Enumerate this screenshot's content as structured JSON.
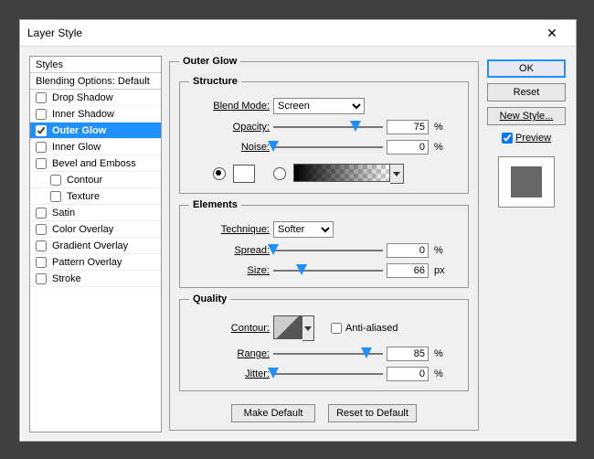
{
  "dialog": {
    "title": "Layer Style"
  },
  "styles_panel": {
    "header": "Styles",
    "blending": "Blending Options: Default",
    "items": [
      {
        "label": "Drop Shadow",
        "checked": false,
        "selected": false,
        "nested": false
      },
      {
        "label": "Inner Shadow",
        "checked": false,
        "selected": false,
        "nested": false
      },
      {
        "label": "Outer Glow",
        "checked": true,
        "selected": true,
        "nested": false
      },
      {
        "label": "Inner Glow",
        "checked": false,
        "selected": false,
        "nested": false
      },
      {
        "label": "Bevel and Emboss",
        "checked": false,
        "selected": false,
        "nested": false
      },
      {
        "label": "Contour",
        "checked": false,
        "selected": false,
        "nested": true
      },
      {
        "label": "Texture",
        "checked": false,
        "selected": false,
        "nested": true
      },
      {
        "label": "Satin",
        "checked": false,
        "selected": false,
        "nested": false
      },
      {
        "label": "Color Overlay",
        "checked": false,
        "selected": false,
        "nested": false
      },
      {
        "label": "Gradient Overlay",
        "checked": false,
        "selected": false,
        "nested": false
      },
      {
        "label": "Pattern Overlay",
        "checked": false,
        "selected": false,
        "nested": false
      },
      {
        "label": "Stroke",
        "checked": false,
        "selected": false,
        "nested": false
      }
    ]
  },
  "outer_group": {
    "title": "Outer Glow"
  },
  "structure": {
    "title": "Structure",
    "blend_mode_label": "Blend Mode:",
    "blend_mode_value": "Screen",
    "opacity_label": "Opacity:",
    "opacity_value": "75",
    "opacity_pct": 75,
    "noise_label": "Noise:",
    "noise_value": "0",
    "noise_pct": 0,
    "unit_percent": "%",
    "color_selected": "solid"
  },
  "elements": {
    "title": "Elements",
    "technique_label": "Technique:",
    "technique_value": "Softer",
    "spread_label": "Spread:",
    "spread_value": "0",
    "spread_pct": 0,
    "size_label": "Size:",
    "size_value": "66",
    "size_pct": 26,
    "unit_percent": "%",
    "unit_px": "px"
  },
  "quality": {
    "title": "Quality",
    "contour_label": "Contour:",
    "aa_label": "Anti-aliased",
    "aa_checked": false,
    "range_label": "Range:",
    "range_value": "85",
    "range_pct": 85,
    "jitter_label": "Jitter:",
    "jitter_value": "0",
    "jitter_pct": 0,
    "unit_percent": "%"
  },
  "buttons": {
    "make_default": "Make Default",
    "reset_default": "Reset to Default",
    "ok": "OK",
    "reset": "Reset",
    "new_style": "New Style..."
  },
  "preview": {
    "label": "Preview",
    "checked": true
  }
}
